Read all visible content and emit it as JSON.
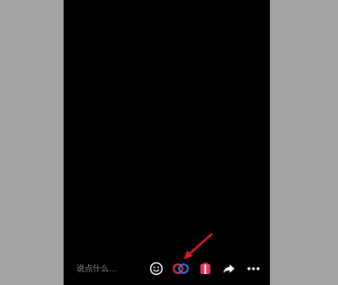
{
  "comment": {
    "placeholder": "说点什么..."
  },
  "toolbar": {
    "icons": [
      "emoji-icon",
      "duet-icon",
      "gift-icon",
      "share-icon",
      "more-icon"
    ]
  },
  "colors": {
    "background_outer": "#a3a3a3",
    "screen": "#000000",
    "gift_accent": "#e6355e",
    "duet_red": "#e03545",
    "duet_blue": "#3b6bd8",
    "arrow": "#e3171f"
  }
}
